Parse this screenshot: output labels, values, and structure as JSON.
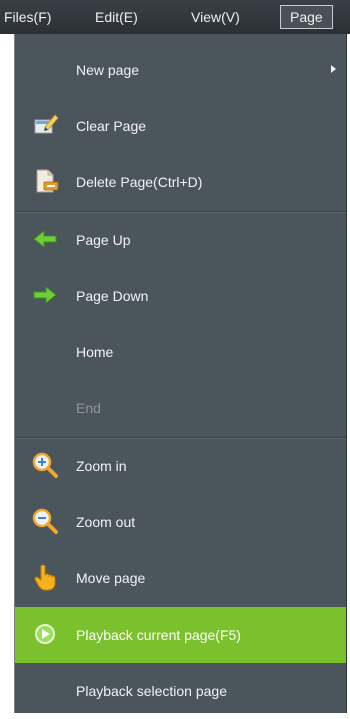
{
  "menubar": {
    "files": "Files(F)",
    "edit": "Edit(E)",
    "view": "View(V)",
    "page": "Page"
  },
  "page_menu": {
    "new_page": "New page",
    "clear_page": "Clear Page",
    "delete_page": "Delete Page(Ctrl+D)",
    "page_up": "Page Up",
    "page_down": "Page Down",
    "home": "Home",
    "end": "End",
    "zoom_in": "Zoom in",
    "zoom_out": "Zoom out",
    "move_page": "Move page",
    "playback_current": "Playback current page(F5)",
    "playback_selection": "Playback selection page"
  },
  "icons": {
    "clear_page": "eraser-icon",
    "delete_page": "delete-page-icon",
    "page_up": "arrow-left-icon",
    "page_down": "arrow-right-icon",
    "zoom_in": "zoom-in-icon",
    "zoom_out": "zoom-out-icon",
    "move_page": "hand-pointer-icon",
    "playback_current": "play-icon"
  },
  "colors": {
    "menu_background": "#4b555c",
    "highlight": "#7bc12e",
    "disabled_text": "#8e979c"
  }
}
